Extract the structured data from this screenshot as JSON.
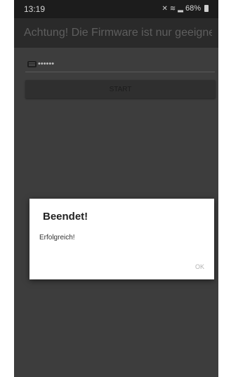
{
  "status_bar": {
    "time": "13:19",
    "battery": "68%"
  },
  "app_bar": {
    "title": "Achtung! Die Firmware ist nur geeignet..."
  },
  "form": {
    "password_value": "••••••",
    "start_label": "START"
  },
  "dialog": {
    "title": "Beendet!",
    "message": "Erfolgreich!",
    "ok_label": "OK"
  },
  "colors": {
    "screen_background": "#3d3d3d",
    "app_bar": "#2a2a2a",
    "status_bar": "#1c1c1c",
    "dialog_background": "#ffffff"
  }
}
